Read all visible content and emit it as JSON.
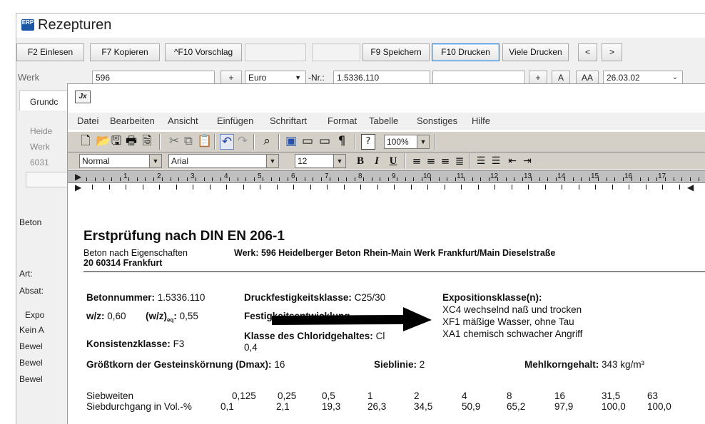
{
  "app": {
    "logo_text": "ERP",
    "title": "Rezepturen",
    "toolbar": [
      "F2 Einlesen",
      "F7 Kopieren",
      "^F10 Vorschlag",
      "F9 Speichern",
      "F10 Drucken",
      "Viele Drucken",
      "<",
      ">"
    ],
    "row2": {
      "werk_label": "Werk",
      "werk_value": "596",
      "plus": "+",
      "currency": "Euro",
      "nr_label": "-Nr.:",
      "nr_value": "1.5336.110",
      "btn_plus": "+",
      "btn_a": "A",
      "btn_aa": "AA",
      "date": "26.03.02"
    },
    "tab_grund": "Grundc",
    "left": {
      "heide": "Heide",
      "werk": "Werk",
      "plz": "6031",
      "beton": "Beton",
      "art": "Art:",
      "absatz": "Absat:",
      "expo": "Expo",
      "kein": "Kein A",
      "bewel": [
        "Bewel",
        "Bewel",
        "Bewel"
      ]
    }
  },
  "editor": {
    "icon_text": "Jx",
    "menu": [
      "Datei",
      "Bearbeiten",
      "Ansicht",
      "Einfügen",
      "Schriftart",
      "Format",
      "Tabelle",
      "Sonstiges",
      "Hilfe"
    ],
    "zoom": "100%",
    "style": "Normal",
    "font": "Arial",
    "size": "12",
    "ruler": [
      "1",
      "2",
      "3",
      "4",
      "5",
      "6",
      "7",
      "8",
      "9",
      "10",
      "11",
      "12",
      "13",
      "14",
      "15",
      "16",
      "17"
    ]
  },
  "document": {
    "title": "Erstprüfung nach DIN EN 206-1",
    "subtitle_left": "Beton nach Eigenschaften",
    "werk_line": "Werk: 596 Heidelberger Beton Rhein-Main Werk Frankfurt/Main Dieselstraße",
    "werk_line2": "20 60314 Frankfurt",
    "betonnummer_label": "Betonnummer:",
    "betonnummer_value": "1.5336.110",
    "druck_label": "Druckfestigkeitsklasse:",
    "druck_value": "C25/30",
    "expo_label": "Expositionsklasse(n):",
    "expo_values": [
      "XC4 wechselnd naß und trocken",
      "XF1 mäßige Wasser, ohne Tau",
      "XA1 chemisch schwacher Angriff"
    ],
    "wz_label": "w/z:",
    "wz_value": "0,60",
    "wzeq_label": "(w/z)",
    "wzeq_sub": "eq",
    "wzeq_value": "0,55",
    "festig_label": "Festigkeitsentwicklung",
    "chlorid_label": "Klasse des Chloridgehaltes:",
    "chlorid_value": "Cl",
    "chlorid_value2": "0,4",
    "konsistenz_label": "Konsistenzklasse:",
    "konsistenz_value": "F3",
    "groesst_label": "Größtkorn der Gesteinskörnung (Dmax):",
    "groesst_value": "16",
    "sieblinie_label": "Sieblinie:",
    "sieblinie_value": "2",
    "mehl_label": "Mehlkorngehalt:",
    "mehl_value": "343 kg/m³",
    "siebweiten_label": "Siebweiten",
    "siebweiten": [
      "0,125",
      "0,25",
      "0,5",
      "1",
      "2",
      "4",
      "8",
      "16",
      "31,5",
      "63"
    ],
    "siebdurchgang_label": "Siebdurchgang in Vol.-%",
    "siebdurchgang": [
      "0,1",
      "2,1",
      "19,3",
      "26,3",
      "34,5",
      "50,9",
      "65,2",
      "97,9",
      "100,0",
      "100,0"
    ]
  }
}
